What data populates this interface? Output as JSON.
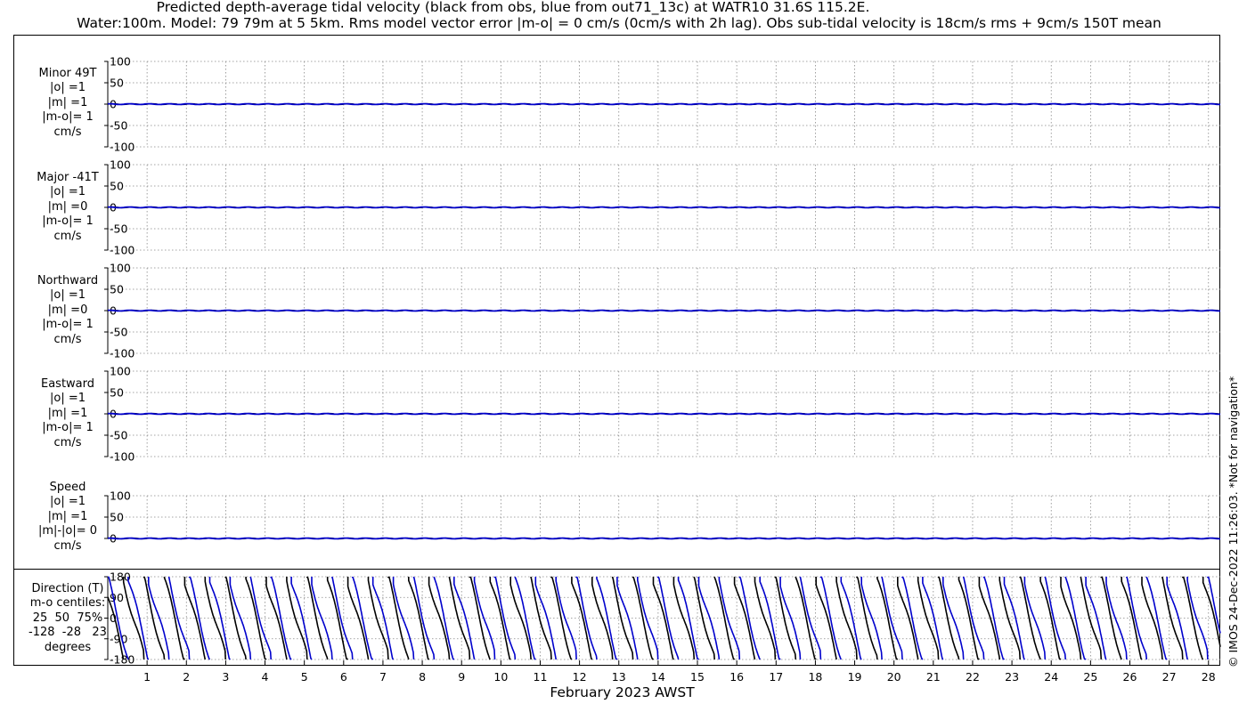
{
  "title_line1": "Predicted depth-average tidal velocity (black from obs, blue from out71_13c) at WATR10 31.6S 115.2E.",
  "title_line2": "Water:100m. Model: 79 79m at 5 5km. Rms model vector error |m-o| = 0 cm/s (0cm/s with 2h lag). Obs sub-tidal velocity is 18cm/s rms + 9cm/s 150T mean",
  "copyright": "© IMOS 24-Dec-2022 11:26:03. *Not for navigation*",
  "xlabel": "February 2023 AWST",
  "colors": {
    "obs": "#000000",
    "model": "#0000cc",
    "grid": "#888888"
  },
  "chart_data": [
    {
      "type": "line",
      "panel": "minor",
      "label_lines": [
        "Minor 49T",
        "|o| =1",
        "|m| =1",
        "|m-o|= 1",
        "cm/s"
      ],
      "ylim": [
        -100,
        100
      ],
      "yticks": [
        100,
        50,
        0,
        -50,
        -100
      ],
      "xlim": [
        0,
        28.3
      ],
      "xticks": [
        1,
        2,
        3,
        4,
        5,
        6,
        7,
        8,
        9,
        10,
        11,
        12,
        13,
        14,
        15,
        16,
        17,
        18,
        19,
        20,
        21,
        22,
        23,
        24,
        25,
        26,
        27,
        28
      ],
      "grid": true,
      "series": [
        {
          "name": "obs",
          "values": [
            0,
            0
          ]
        },
        {
          "name": "out71_13c",
          "values": [
            0,
            0
          ]
        }
      ]
    },
    {
      "type": "line",
      "panel": "major",
      "label_lines": [
        "Major -41T",
        "|o| =1",
        "|m| =0",
        "|m-o|= 1",
        "cm/s"
      ],
      "ylim": [
        -100,
        100
      ],
      "yticks": [
        100,
        50,
        0,
        -50,
        -100
      ],
      "xlim": [
        0,
        28.3
      ],
      "grid": true,
      "series": [
        {
          "name": "obs",
          "values": [
            0,
            0
          ]
        },
        {
          "name": "out71_13c",
          "values": [
            0,
            0
          ]
        }
      ]
    },
    {
      "type": "line",
      "panel": "northward",
      "label_lines": [
        "Northward",
        "|o| =1",
        "|m| =0",
        "|m-o|= 1",
        "cm/s"
      ],
      "ylim": [
        -100,
        100
      ],
      "yticks": [
        100,
        50,
        0,
        -50,
        -100
      ],
      "xlim": [
        0,
        28.3
      ],
      "grid": true,
      "series": [
        {
          "name": "obs",
          "values": [
            0,
            0
          ]
        },
        {
          "name": "out71_13c",
          "values": [
            0,
            0
          ]
        }
      ]
    },
    {
      "type": "line",
      "panel": "eastward",
      "label_lines": [
        "Eastward",
        "|o| =1",
        "|m| =1",
        "|m-o|= 1",
        "cm/s"
      ],
      "ylim": [
        -100,
        100
      ],
      "yticks": [
        100,
        50,
        0,
        -50,
        -100
      ],
      "xlim": [
        0,
        28.3
      ],
      "grid": true,
      "series": [
        {
          "name": "obs",
          "values": [
            0,
            0
          ]
        },
        {
          "name": "out71_13c",
          "values": [
            0,
            0
          ]
        }
      ]
    },
    {
      "type": "line",
      "panel": "speed",
      "label_lines": [
        "Speed",
        "|o| =1",
        "|m| =1",
        "|m|-|o|= 0",
        "cm/s"
      ],
      "ylim": [
        0,
        100
      ],
      "yticks": [
        100,
        50,
        0
      ],
      "xlim": [
        0,
        28.3
      ],
      "grid": true,
      "series": [
        {
          "name": "obs",
          "values": [
            0,
            0
          ]
        },
        {
          "name": "out71_13c",
          "values": [
            0,
            0
          ]
        }
      ]
    },
    {
      "type": "line",
      "panel": "direction",
      "label_lines": [
        "Direction (T)",
        "m-o centiles:",
        "25  50  75%",
        "-128  -28   23",
        "degrees"
      ],
      "ylim": [
        -180,
        180
      ],
      "yticks": [
        180,
        90,
        0,
        -90,
        -180
      ],
      "xlim": [
        0,
        28.3
      ],
      "grid": true,
      "tidal_cycles_per_day": 1.93,
      "obs_phase_offset_days": 0.12,
      "series": [
        {
          "name": "obs",
          "start_deg": 120,
          "rate_deg_per_day": -700
        },
        {
          "name": "out71_13c",
          "start_deg": 150,
          "rate_deg_per_day": -700
        }
      ]
    }
  ]
}
